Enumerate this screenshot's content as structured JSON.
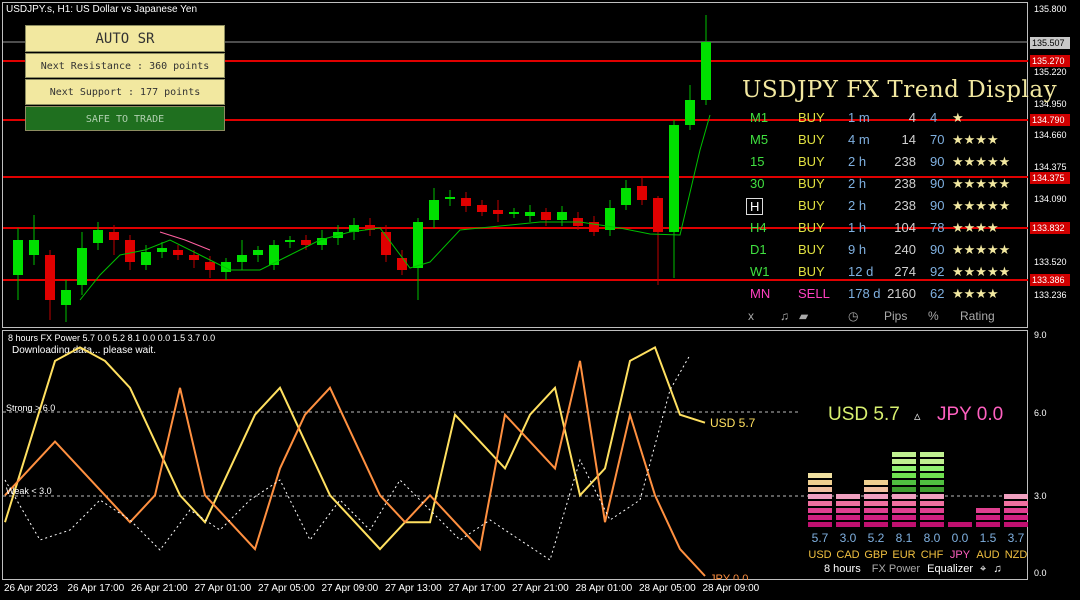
{
  "header": {
    "title": "USDJPY.s, H1:  US Dollar vs Japanese Yen"
  },
  "sr_panel": {
    "title": "AUTO SR",
    "resistance": "Next Resistance : 360 points",
    "support": "Next Support : 177 points",
    "status": "SAFE TO TRADE"
  },
  "price_axis": [
    "135.800",
    "135.220",
    "134.950",
    "134.660",
    "134.375",
    "134.090",
    "133.520",
    "133.236"
  ],
  "price_tags": {
    "current": "135.507",
    "r1": "135.270",
    "r2": "134.790",
    "r3": "134.375",
    "r4": "133.832",
    "r5": "133.386"
  },
  "trend": {
    "title": "USDJPY FX Trend Display",
    "rows": [
      {
        "tf": "M1",
        "dir": "BUY",
        "dur": "1 m",
        "pips": "4",
        "pct": "4",
        "stars": "★"
      },
      {
        "tf": "M5",
        "dir": "BUY",
        "dur": "4 m",
        "pips": "14",
        "pct": "70",
        "stars": "★★★★"
      },
      {
        "tf": "15",
        "dir": "BUY",
        "dur": "2 h",
        "pips": "238",
        "pct": "90",
        "stars": "★★★★★"
      },
      {
        "tf": "30",
        "dir": "BUY",
        "dur": "2 h",
        "pips": "238",
        "pct": "90",
        "stars": "★★★★★"
      },
      {
        "tf": "H",
        "dir": "BUY",
        "dur": "2 h",
        "pips": "238",
        "pct": "90",
        "stars": "★★★★★"
      },
      {
        "tf": "H4",
        "dir": "BUY",
        "dur": "1 h",
        "pips": "104",
        "pct": "78",
        "stars": "★★★★"
      },
      {
        "tf": "D1",
        "dir": "BUY",
        "dur": "9 h",
        "pips": "240",
        "pct": "90",
        "stars": "★★★★★"
      },
      {
        "tf": "W1",
        "dir": "BUY",
        "dur": "12 d",
        "pips": "274",
        "pct": "92",
        "stars": "★★★★★"
      },
      {
        "tf": "MN",
        "dir": "SELL",
        "dur": "178 d",
        "pips": "2160",
        "pct": "62",
        "stars": "★★★★"
      }
    ],
    "footer": {
      "close": "x",
      "music": "♫",
      "clock": "◷",
      "pips": "Pips",
      "pct": "%",
      "rating": "Rating"
    }
  },
  "power": {
    "header": "8 hours FX Power 5.7 0.0 5.2 8.1 0.0 0.0 1.5 3.7 0.0",
    "status": "Downloading data... please wait.",
    "strong_label": "Strong > 6.0",
    "weak_label": "Weak < 3.0",
    "axis": [
      "9.0",
      "6.0",
      "3.0",
      "0.0"
    ],
    "usd_label": "USD 5.7",
    "jpy_label": "JPY 0.0",
    "big_usd": "USD 5.7",
    "big_arrow": "▵",
    "big_jpy": "JPY 0.0"
  },
  "equalizer": {
    "currencies": [
      {
        "cur": "USD",
        "val": "5.7",
        "color": "#f0c040"
      },
      {
        "cur": "CAD",
        "val": "3.0",
        "color": "#f0c040"
      },
      {
        "cur": "GBP",
        "val": "5.2",
        "color": "#f0c040"
      },
      {
        "cur": "EUR",
        "val": "8.1",
        "color": "#f0c040"
      },
      {
        "cur": "CHF",
        "val": "8.0",
        "color": "#f0c040"
      },
      {
        "cur": "JPY",
        "val": "0.0",
        "color": "#ff60c0"
      },
      {
        "cur": "AUD",
        "val": "1.5",
        "color": "#f0c040"
      },
      {
        "cur": "NZD",
        "val": "3.7",
        "color": "#f0c040"
      }
    ],
    "footer": {
      "hours": "8 hours",
      "name": "FX Power",
      "eq": "Equalizer",
      "sound": "♫",
      "cross": "⌖"
    }
  },
  "time_axis": [
    "26 Apr 2023",
    "26 Apr 17:00",
    "26 Apr 21:00",
    "27 Apr 01:00",
    "27 Apr 05:00",
    "27 Apr 09:00",
    "27 Apr 13:00",
    "27 Apr 17:00",
    "27 Apr 21:00",
    "28 Apr 01:00",
    "28 Apr 05:00",
    "28 Apr 09:00"
  ],
  "colors": {
    "bull": "#00e000",
    "bear": "#e00000",
    "resistance": "#e00000",
    "usd_line": "#ffe060",
    "jpy_line": "#ff9040"
  },
  "chart_data": {
    "type": "line",
    "series": [
      {
        "name": "USD",
        "values": [
          2,
          5,
          8,
          8.5,
          8,
          7,
          5,
          3,
          2,
          4,
          6,
          7,
          5,
          3,
          2,
          1,
          2,
          2,
          6,
          5,
          4,
          6,
          7,
          3,
          4,
          8,
          8.5,
          6,
          5.7
        ]
      },
      {
        "name": "JPY",
        "values": [
          3,
          4,
          5,
          4,
          3,
          2,
          3,
          7,
          3,
          2,
          1,
          4,
          6,
          7,
          5,
          3,
          2,
          3,
          2,
          1,
          6,
          5,
          4,
          8,
          2,
          6,
          3,
          1,
          0.0
        ]
      }
    ],
    "ylim": [
      0,
      9
    ]
  }
}
